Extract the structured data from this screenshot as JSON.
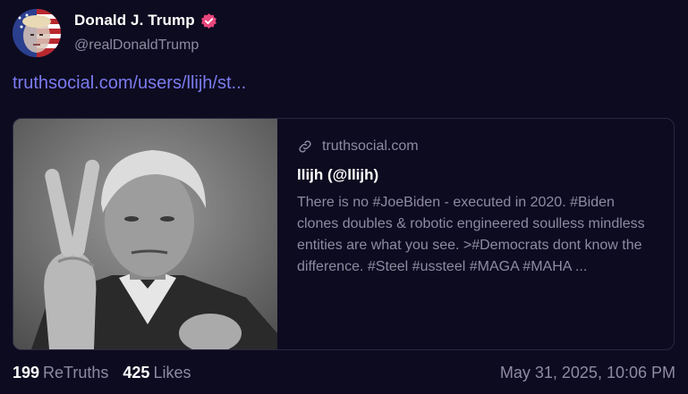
{
  "author": {
    "display_name": "Donald J. Trump",
    "handle": "@realDonaldTrump",
    "verified": true,
    "badge_color": "#e8467c"
  },
  "post": {
    "link_text": "truthsocial.com/users/llijh/st..."
  },
  "link_card": {
    "domain": "truthsocial.com",
    "title": "llijh (@llijh)",
    "description": "There is no #JoeBiden - executed in 2020. #Biden clones doubles & robotic engineered soulless mindless entities are what you see. >#Democrats dont know the difference. #Steel #ussteel #MAGA #MAHA ..."
  },
  "stats": {
    "retruths_count": "199",
    "retruths_label": "ReTruths",
    "likes_count": "425",
    "likes_label": "Likes"
  },
  "timestamp": "May 31, 2025, 10:06 PM",
  "colors": {
    "background": "#0d0b1f",
    "link": "#7b7bf0",
    "muted": "#8e8aa3",
    "card_border": "#2a2744"
  }
}
